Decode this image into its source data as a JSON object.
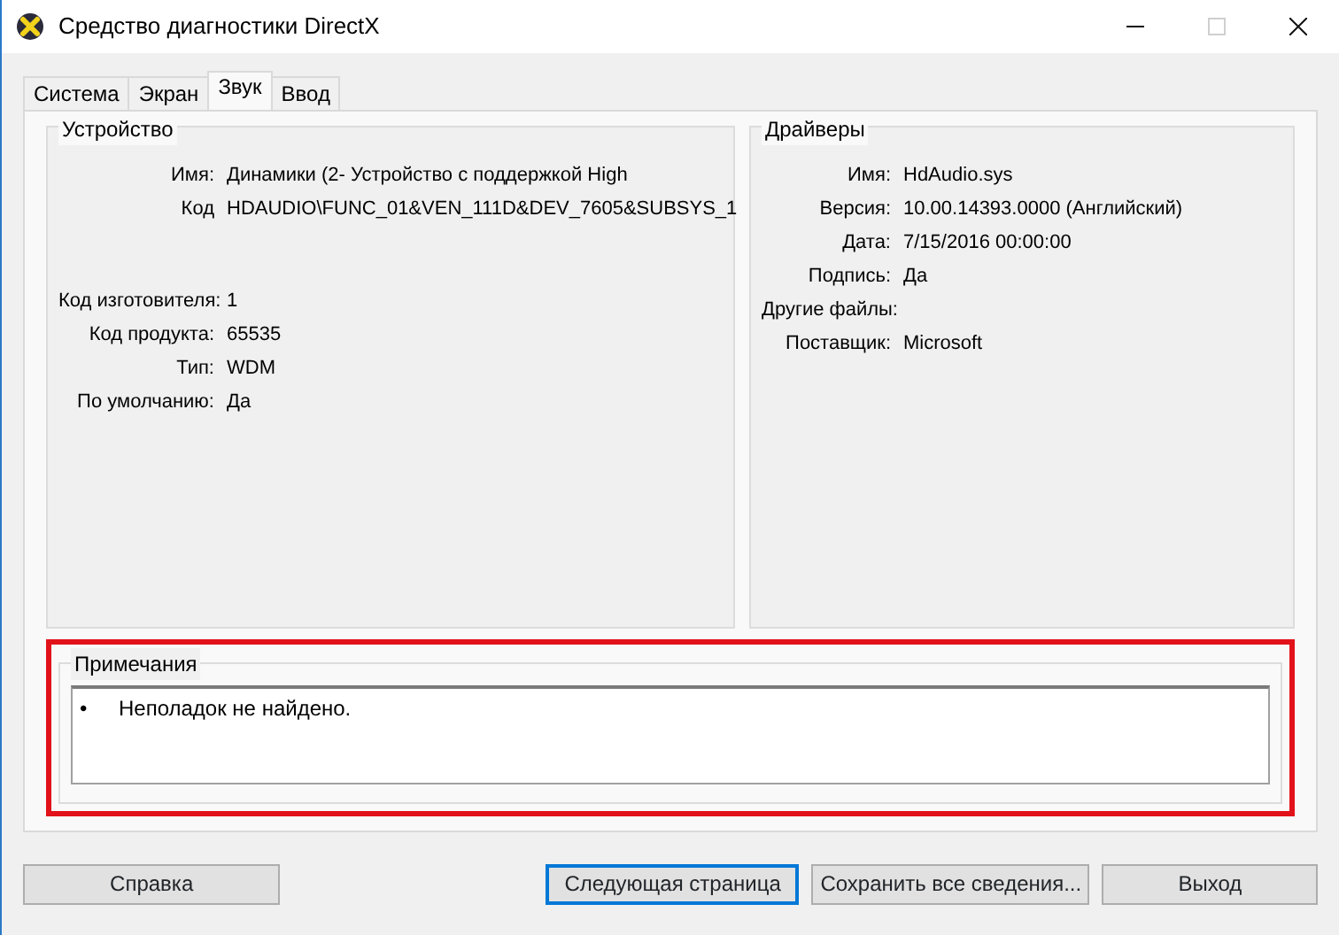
{
  "window": {
    "title": "Средство диагностики DirectX",
    "controls": [
      {
        "kind": "minimize",
        "disabled": false
      },
      {
        "kind": "maximize",
        "disabled": true
      },
      {
        "kind": "close",
        "disabled": false
      }
    ]
  },
  "tabs": [
    {
      "label": "Система",
      "selected": false
    },
    {
      "label": "Экран",
      "selected": false
    },
    {
      "label": "Звук",
      "selected": true
    },
    {
      "label": "Ввод",
      "selected": false
    }
  ],
  "device": {
    "title": "Устройство",
    "fields": [
      {
        "label": "Имя:",
        "value": "Динамики (2- Устройство с поддержкой High"
      },
      {
        "label": "Код",
        "value": "HDAUDIO\\FUNC_01&VEN_111D&DEV_7605&SUBSYS_1"
      }
    ],
    "details": [
      {
        "label": "Код изготовителя:",
        "value": "1"
      },
      {
        "label": "Код продукта:",
        "value": "65535"
      },
      {
        "label": "Тип:",
        "value": "WDM"
      },
      {
        "label": "По умолчанию:",
        "value": "Да"
      }
    ]
  },
  "drivers": {
    "title": "Драйверы",
    "fields": [
      {
        "label": "Имя:",
        "value": "HdAudio.sys"
      },
      {
        "label": "Версия:",
        "value": "10.00.14393.0000 (Английский)"
      },
      {
        "label": "Дата:",
        "value": "7/15/2016 00:00:00"
      },
      {
        "label": "Подпись:",
        "value": "Да"
      },
      {
        "label": "Другие файлы:"
      },
      {
        "label": "Поставщик:",
        "value": "Microsoft"
      }
    ]
  },
  "notes": {
    "title": "Примечания",
    "highlighted": true,
    "items": [
      {
        "bullet": "•",
        "text": "Неполадок не найдено."
      }
    ]
  },
  "buttons": [
    {
      "label": "Справка",
      "default": false
    },
    {
      "label": "Следующая страница",
      "default": true
    },
    {
      "label": "Сохранить все сведения...",
      "default": false
    },
    {
      "label": "Выход",
      "default": false
    }
  ]
}
